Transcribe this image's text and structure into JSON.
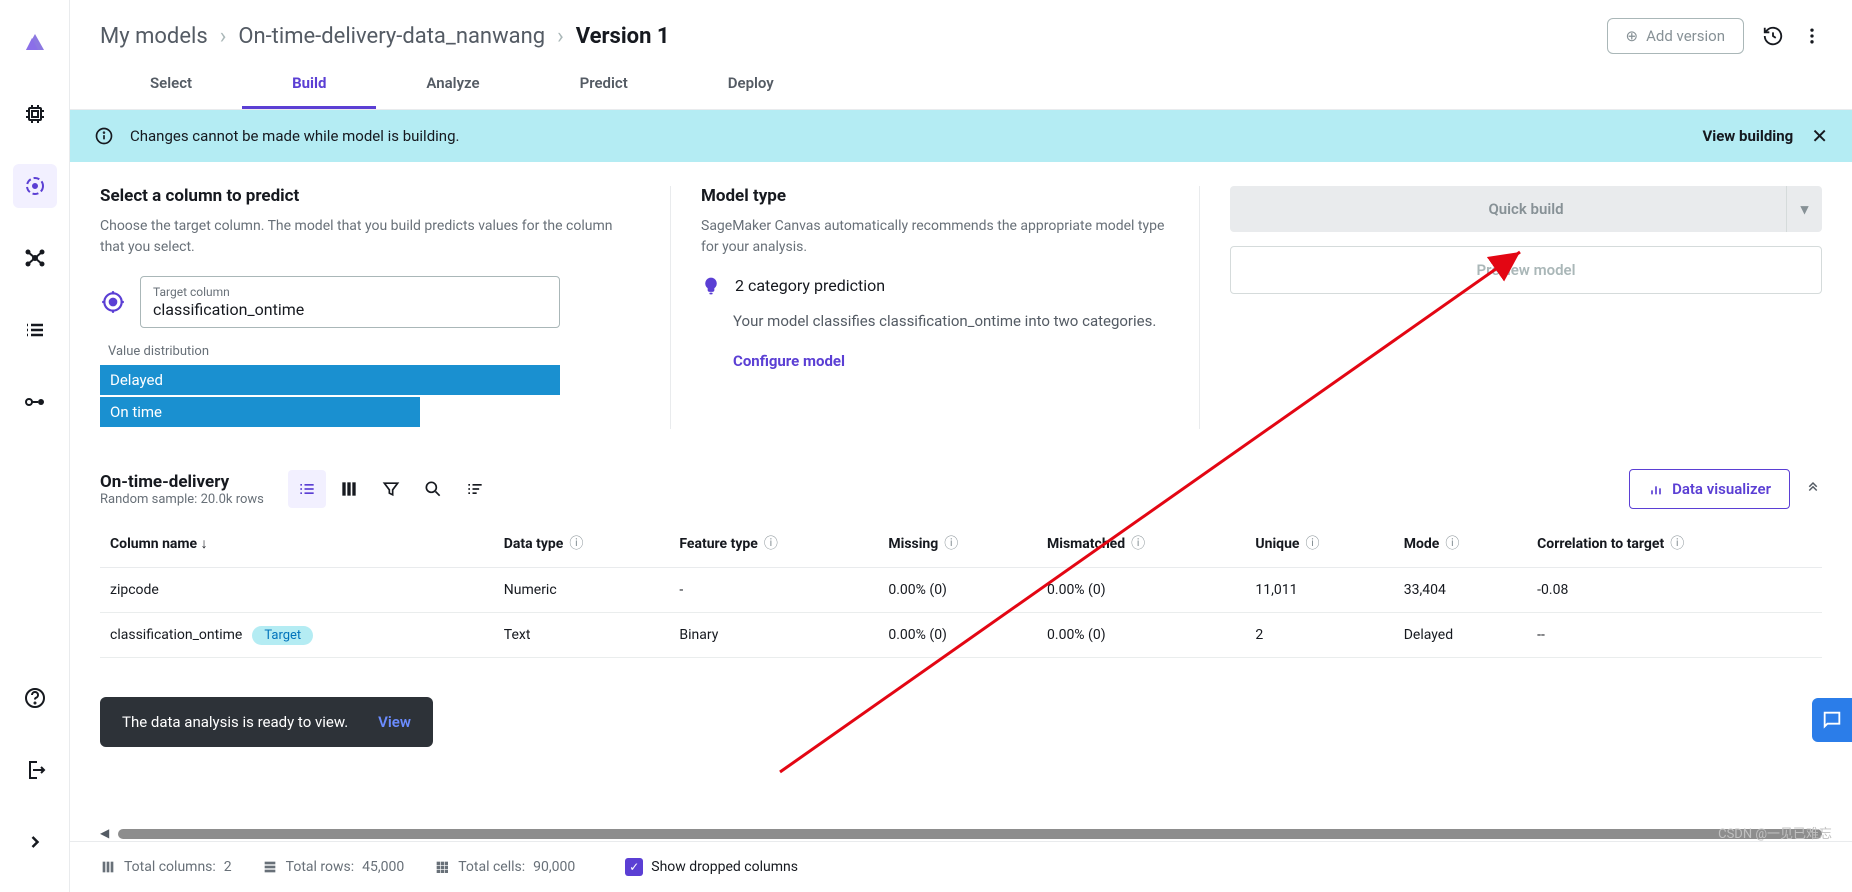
{
  "breadcrumb": {
    "root": "My models",
    "model": "On-time-delivery-data_nanwang",
    "version": "Version 1"
  },
  "header": {
    "add_version": "Add version"
  },
  "tabs": [
    "Select",
    "Build",
    "Analyze",
    "Predict",
    "Deploy"
  ],
  "active_tab": "Build",
  "banner": {
    "msg": "Changes cannot be made while model is building.",
    "link": "View building"
  },
  "select_col": {
    "heading": "Select a column to predict",
    "desc": "Choose the target column. The model that you build predicts values for the column that you select.",
    "target_label": "Target column",
    "target_value": "classification_ontime",
    "vd_label": "Value distribution",
    "bars": [
      "Delayed",
      "On time"
    ]
  },
  "model_type": {
    "heading": "Model type",
    "desc": "SageMaker Canvas automatically recommends the appropriate model type for your analysis.",
    "pred_title": "2 category prediction",
    "pred_desc": "Your model classifies classification_ontime into two categories.",
    "configure": "Configure model"
  },
  "build_btns": {
    "quick": "Quick build",
    "preview": "Preview model"
  },
  "dataset": {
    "title": "On-time-delivery",
    "sample_label": "Random sample:",
    "sample_value": "20.0k rows",
    "dv": "Data visualizer",
    "cols": [
      "Column name",
      "Data type",
      "Feature type",
      "Missing",
      "Mismatched",
      "Unique",
      "Mode",
      "Correlation to target"
    ],
    "rows": [
      {
        "name": "zipcode",
        "dtype": "Numeric",
        "ftype": "-",
        "missing": "0.00% (0)",
        "mismatch": "0.00% (0)",
        "unique": "11,011",
        "mode": "33,404",
        "corr": "-0.08",
        "target": false
      },
      {
        "name": "classification_ontime",
        "dtype": "Text",
        "ftype": "Binary",
        "missing": "0.00% (0)",
        "mismatch": "0.00% (0)",
        "unique": "2",
        "mode": "Delayed",
        "corr": "--",
        "target": true
      }
    ],
    "target_badge": "Target"
  },
  "toast": {
    "msg": "The data analysis is ready to view.",
    "action": "View"
  },
  "footer": {
    "cols_label": "Total columns:",
    "cols": "2",
    "rows_label": "Total rows:",
    "rows": "45,000",
    "cells_label": "Total cells:",
    "cells": "90,000",
    "show_dropped": "Show dropped columns"
  },
  "watermark": "CSDN @一见已难忘"
}
